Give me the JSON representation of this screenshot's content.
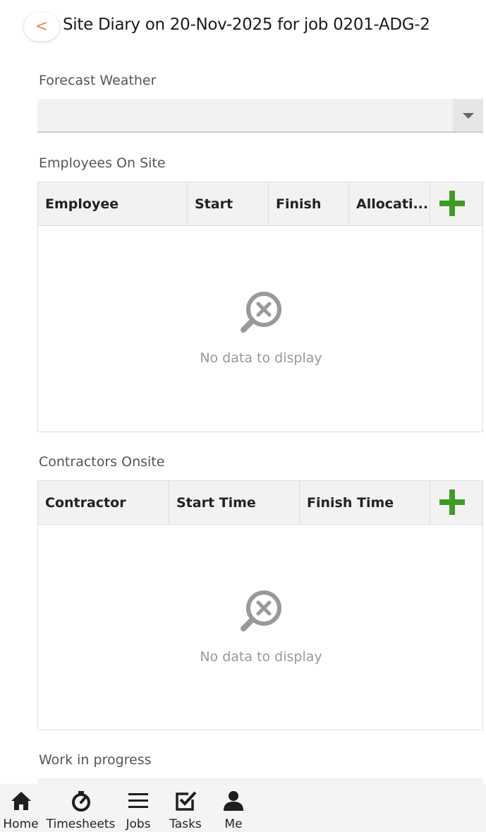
{
  "header": {
    "back_label": "<",
    "title": "Site Diary on 20-Nov-2025 for job 0201-ADG-2"
  },
  "forecast_weather": {
    "label": "Forecast Weather",
    "value": ""
  },
  "employees_on_site": {
    "label": "Employees On Site",
    "columns": [
      "Employee",
      "Start",
      "Finish",
      "Allocati..."
    ],
    "add_icon": "plus-icon",
    "empty_text": "No data to display"
  },
  "contractors_onsite": {
    "label": "Contractors Onsite",
    "columns": [
      "Contractor",
      "Start Time",
      "Finish Time"
    ],
    "add_icon": "plus-icon",
    "empty_text": "No data to display"
  },
  "work_in_progress": {
    "label": "Work in progress"
  },
  "bottom_nav": {
    "items": [
      {
        "label": "Home",
        "icon": "home-icon"
      },
      {
        "label": "Timesheets",
        "icon": "stopwatch-icon"
      },
      {
        "label": "Jobs",
        "icon": "list-icon"
      },
      {
        "label": "Tasks",
        "icon": "checkbox-icon"
      },
      {
        "label": "Me",
        "icon": "user-icon"
      }
    ]
  },
  "colors": {
    "accent_back": "#f0834a",
    "add_green": "#3f9b26",
    "header_bg": "#f2f2f2",
    "muted_text": "#999999"
  }
}
